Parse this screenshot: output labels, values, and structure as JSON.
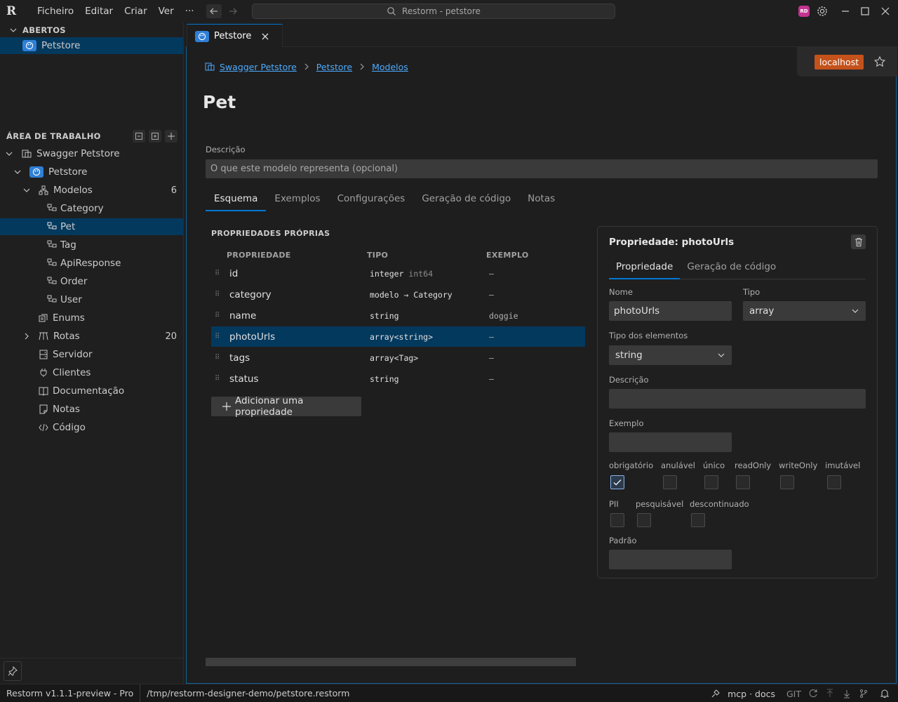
{
  "titlebar": {
    "logo": "R",
    "menu": [
      "Ficheiro",
      "Editar",
      "Criar",
      "Ver",
      "···"
    ],
    "command_center": "Restorm - petstore",
    "avatar_initials": "RD"
  },
  "sidebar": {
    "open_header": "ABERTOS",
    "open_items": [
      {
        "label": "Petstore"
      }
    ],
    "workspace_header": "ÁREA DE TRABALHO",
    "tree": {
      "root": "Swagger Petstore",
      "app": "Petstore",
      "models": {
        "label": "Modelos",
        "count": "6"
      },
      "model_items": [
        "Category",
        "Pet",
        "Tag",
        "ApiResponse",
        "Order",
        "User"
      ],
      "enums": "Enums",
      "routes": {
        "label": "Rotas",
        "count": "20"
      },
      "server": "Servidor",
      "clients": "Clientes",
      "docs": "Documentação",
      "notes": "Notas",
      "code": "Código"
    }
  },
  "tab": {
    "label": "Petstore"
  },
  "editor": {
    "breadcrumb": [
      "Swagger Petstore",
      "Petstore",
      "Modelos"
    ],
    "server_badge": "localhost",
    "title": "Pet",
    "description_label": "Descrição",
    "description_placeholder": "O que este modelo representa (opcional)",
    "tabs": [
      "Esquema",
      "Exemplos",
      "Configurações",
      "Geração de código",
      "Notas"
    ],
    "props_title": "PROPRIEDADES PRÓPRIAS",
    "columns": [
      "PROPRIEDADE",
      "TIPO",
      "EXEMPLO"
    ],
    "properties": [
      {
        "name": "id",
        "type": "integer",
        "type_extra": "int64",
        "example": "–"
      },
      {
        "name": "category",
        "type": "modelo → Category",
        "type_extra": "",
        "example": "–"
      },
      {
        "name": "name",
        "type": "string",
        "type_extra": "",
        "example": "doggie"
      },
      {
        "name": "photoUrls",
        "type": "array<string>",
        "type_extra": "",
        "example": "–"
      },
      {
        "name": "tags",
        "type": "array<Tag>",
        "type_extra": "",
        "example": "–"
      },
      {
        "name": "status",
        "type": "string",
        "type_extra": "",
        "example": "–"
      }
    ],
    "add_property": "Adicionar uma propriedade"
  },
  "panel": {
    "title": "Propriedade: photoUrls",
    "tabs": [
      "Propriedade",
      "Geração de código"
    ],
    "name_label": "Nome",
    "name_value": "photoUrls",
    "type_label": "Tipo",
    "type_value": "array",
    "element_type_label": "Tipo dos elementos",
    "element_type_value": "string",
    "description_label": "Descrição",
    "description_value": "",
    "example_label": "Exemplo",
    "example_value": "",
    "flags_row1": [
      {
        "label": "obrigatório",
        "checked": true
      },
      {
        "label": "anulável",
        "checked": false
      },
      {
        "label": "único",
        "checked": false
      },
      {
        "label": "readOnly",
        "checked": false
      },
      {
        "label": "writeOnly",
        "checked": false
      },
      {
        "label": "imutável",
        "checked": false
      }
    ],
    "flags_row2": [
      {
        "label": "PII",
        "checked": false
      },
      {
        "label": "pesquisável",
        "checked": false
      },
      {
        "label": "descontinuado",
        "checked": false
      }
    ],
    "default_label": "Padrão",
    "default_value": ""
  },
  "statusbar": {
    "version": "Restorm v1.1.1-preview - Pro",
    "path": "/tmp/restorm-designer-demo/petstore.restorm",
    "mcp": "mcp · docs",
    "git": "GIT"
  },
  "colors": {
    "accent": "#0078d4",
    "selection": "#04395e",
    "server_badge": "#c4521b",
    "app_badge": "#2f7fd6"
  }
}
